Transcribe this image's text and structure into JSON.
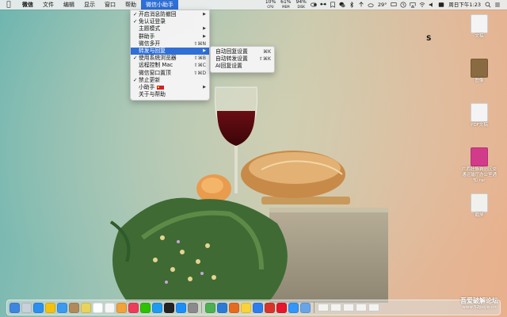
{
  "menubar": {
    "app_menus": [
      "微信",
      "文件",
      "编辑",
      "显示",
      "窗口",
      "帮助"
    ],
    "active_menu": "微信小助手",
    "stats": [
      {
        "value": "10%",
        "unit": "CPU"
      },
      {
        "value": "61%",
        "unit": "MEM"
      },
      {
        "value": "94%",
        "unit": "DISK"
      }
    ],
    "weather": "29°",
    "datetime": "周日下午1:23"
  },
  "dropdown": {
    "items": [
      {
        "label": "开启消息防撤回",
        "checked": true,
        "shortcut": "",
        "submenu": true
      },
      {
        "label": "免认证登录",
        "checked": true,
        "shortcut": "",
        "submenu": false
      },
      {
        "label": "主题模式",
        "checked": false,
        "shortcut": "",
        "submenu": true
      },
      {
        "label": "群助手",
        "checked": false,
        "shortcut": "",
        "submenu": true
      },
      {
        "label": "微信多开",
        "checked": false,
        "shortcut": "⇧⌘N",
        "submenu": false
      },
      {
        "label": "转发与回复",
        "checked": false,
        "shortcut": "",
        "submenu": true,
        "highlight": true
      },
      {
        "label": "使用系统浏览器",
        "checked": true,
        "shortcut": "⇧⌘B",
        "submenu": false
      },
      {
        "label": "远程控制 Mac",
        "checked": false,
        "shortcut": "⇧⌘C",
        "submenu": false
      },
      {
        "label": "微信窗口置顶",
        "checked": false,
        "shortcut": "⇧⌘D",
        "submenu": false
      },
      {
        "label": "禁止更新",
        "checked": true,
        "shortcut": "",
        "submenu": false
      },
      {
        "label": "小助手",
        "checked": false,
        "shortcut": "",
        "submenu": true,
        "flag": true
      },
      {
        "label": "关于与帮助",
        "checked": false,
        "shortcut": "",
        "submenu": false
      }
    ]
  },
  "submenu": {
    "items": [
      {
        "label": "自动回复设置",
        "shortcut": "⌘K"
      },
      {
        "label": "自动转发设置",
        "shortcut": "⇧⌘K"
      },
      {
        "label": "AI回复设置",
        "shortcut": ""
      }
    ]
  },
  "desktop": {
    "icons": [
      {
        "label": "文稿",
        "icon": "doc-icon",
        "color": "#f4f4f4"
      },
      {
        "label": "图像",
        "icon": "photo-icon",
        "color": "#8a6a40"
      },
      {
        "label": "PDF文稿",
        "icon": "pdf-icon",
        "color": "#f4f4f4"
      },
      {
        "label": "广西壮族自治区交通运输厅办公室通知.rar",
        "icon": "rar-archive-icon",
        "color": "#d23b8a"
      },
      {
        "label": "截屏",
        "icon": "screenshot-icon",
        "color": "#f0f0ec"
      }
    ],
    "cursor_text": "S"
  },
  "dock": {
    "apps": [
      {
        "name": "finder-icon",
        "color": "#3d86e0"
      },
      {
        "name": "launchpad-icon",
        "color": "#c8d0d8"
      },
      {
        "name": "safari-icon",
        "color": "#2a8ff0"
      },
      {
        "name": "chrome-icon",
        "color": "#f4c20d"
      },
      {
        "name": "mail-icon",
        "color": "#3b9af0"
      },
      {
        "name": "contacts-icon",
        "color": "#b08a5a"
      },
      {
        "name": "notes-icon",
        "color": "#e8d35c"
      },
      {
        "name": "calendar-icon",
        "color": "#ffffff"
      },
      {
        "name": "reminders-icon",
        "color": "#f6f6f6"
      },
      {
        "name": "photos-icon",
        "color": "#f2a23a"
      },
      {
        "name": "music-icon",
        "color": "#ee3d59"
      },
      {
        "name": "wechat-icon",
        "color": "#2dc100"
      },
      {
        "name": "qq-icon",
        "color": "#1d9bf0"
      },
      {
        "name": "terminal-icon",
        "color": "#222222"
      },
      {
        "name": "appstore-icon",
        "color": "#1c8ef9"
      },
      {
        "name": "settings-icon",
        "color": "#8a8a8a"
      },
      {
        "name": "maps-icon",
        "color": "#4cb050"
      },
      {
        "name": "vscode-icon",
        "color": "#2b7bd6"
      },
      {
        "name": "firefox-icon",
        "color": "#e66b1f"
      },
      {
        "name": "qqmusic-icon",
        "color": "#f8d33a"
      },
      {
        "name": "baidu-netdisk-icon",
        "color": "#2c7ef0"
      },
      {
        "name": "wps-icon",
        "color": "#d9342b"
      },
      {
        "name": "weibo-icon",
        "color": "#e6162d"
      },
      {
        "name": "dingtalk-icon",
        "color": "#3296fa"
      },
      {
        "name": "preview-icon",
        "color": "#6aa4e8"
      }
    ]
  },
  "watermark": {
    "line1": "吾爱破解论坛",
    "line2": "www.52pojie.cn"
  }
}
